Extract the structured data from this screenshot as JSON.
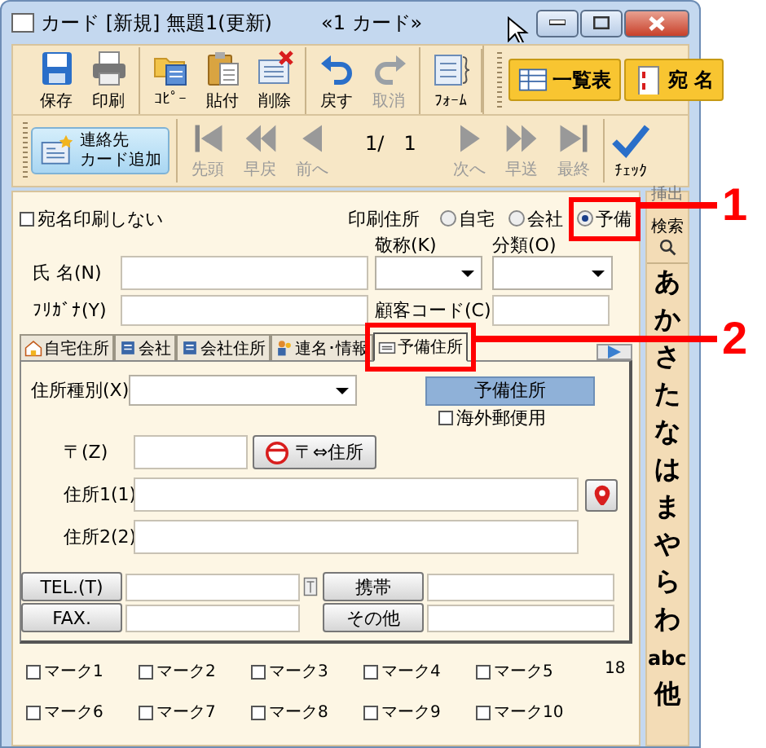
{
  "window": {
    "title": "カード [新規] 無題1(更新)",
    "subtitle": "«1 カード»"
  },
  "toolbar": [
    [
      {
        "label": "保存",
        "kind": "save",
        "disabled": false
      },
      {
        "label": "印刷",
        "kind": "print",
        "disabled": false
      }
    ],
    [
      {
        "label": "ｺﾋﾟｰ",
        "kind": "copy",
        "disabled": false
      },
      {
        "label": "貼付",
        "kind": "paste",
        "disabled": false
      },
      {
        "label": "削除",
        "kind": "delete",
        "disabled": false
      }
    ],
    [
      {
        "label": "戻す",
        "kind": "undo",
        "disabled": false
      },
      {
        "label": "取消",
        "kind": "redo",
        "disabled": true
      }
    ],
    [
      {
        "label": "ﾌｫｰﾑ",
        "kind": "form",
        "disabled": false
      }
    ]
  ],
  "toolbar_right": [
    {
      "label": "一覧表",
      "kind": "list"
    },
    {
      "label": "宛 名",
      "kind": "card"
    }
  ],
  "navigation": {
    "add_button": [
      "連絡先",
      "カード追加"
    ],
    "back": [
      {
        "label": "先頭",
        "kind": "first",
        "disabled": true
      },
      {
        "label": "早戻",
        "kind": "rewind",
        "disabled": true
      },
      {
        "label": "前へ",
        "kind": "prev",
        "disabled": true
      }
    ],
    "position": "1/",
    "total": "1",
    "forward": [
      {
        "label": "次へ",
        "kind": "next",
        "disabled": true
      },
      {
        "label": "早送",
        "kind": "forward",
        "disabled": true
      },
      {
        "label": "最終",
        "kind": "last",
        "disabled": true
      }
    ],
    "check": "ﾁｪｯｸ"
  },
  "print_options": {
    "no_print": {
      "label": "宛名印刷しない",
      "checked": false
    },
    "address_label": "印刷住所",
    "address_options": [
      {
        "label": "自宅",
        "selected": false
      },
      {
        "label": "会社",
        "selected": false
      },
      {
        "label": "予備",
        "selected": true
      }
    ]
  },
  "fields": {
    "name_label": "氏 名(N)",
    "title_label": "敬称(K)",
    "category_label": "分類(O)",
    "kana_label": "ﾌﾘｶﾞﾅ(Y)",
    "code_label": "顧客コード(C)"
  },
  "tabs": [
    {
      "label": "自宅住所",
      "kind": "home",
      "selected": false
    },
    {
      "label": "会社",
      "kind": "company",
      "selected": false
    },
    {
      "label": "会社住所",
      "kind": "company",
      "selected": false
    },
    {
      "label": "連名･情報",
      "kind": "people",
      "selected": false
    },
    {
      "label": "予備住所",
      "kind": "spare",
      "selected": true
    }
  ],
  "address_panel": {
    "type_label": "住所種別(X)",
    "header": "予備住所",
    "overseas": {
      "label": "海外郵便用",
      "checked": false
    },
    "zip_label": "〒(Z)",
    "zip_button": "〒⇔住所",
    "address1_label": "住所1(1)",
    "address2_label": "住所2(2)",
    "phones": [
      {
        "button": "TEL.(T)"
      },
      {
        "button": "携帯"
      },
      {
        "button": "FAX."
      },
      {
        "button": "その他"
      }
    ]
  },
  "marks": [
    {
      "label": "マーク1",
      "checked": false
    },
    {
      "label": "マーク2",
      "checked": false
    },
    {
      "label": "マーク3",
      "checked": false
    },
    {
      "label": "マーク4",
      "checked": false
    },
    {
      "label": "マーク5",
      "checked": false
    },
    {
      "label": "マーク6",
      "checked": false
    },
    {
      "label": "マーク7",
      "checked": false
    },
    {
      "label": "マーク8",
      "checked": false
    },
    {
      "label": "マーク9",
      "checked": false
    },
    {
      "label": "マーク10",
      "checked": false
    }
  ],
  "mark_count": "18",
  "index_bar": {
    "top": "挿出",
    "search": "検索",
    "letters": [
      "あ",
      "か",
      "さ",
      "た",
      "な",
      "は",
      "ま",
      "や",
      "ら",
      "わ",
      "abc",
      "他"
    ]
  },
  "callouts": [
    {
      "number": "1"
    },
    {
      "number": "2"
    }
  ]
}
